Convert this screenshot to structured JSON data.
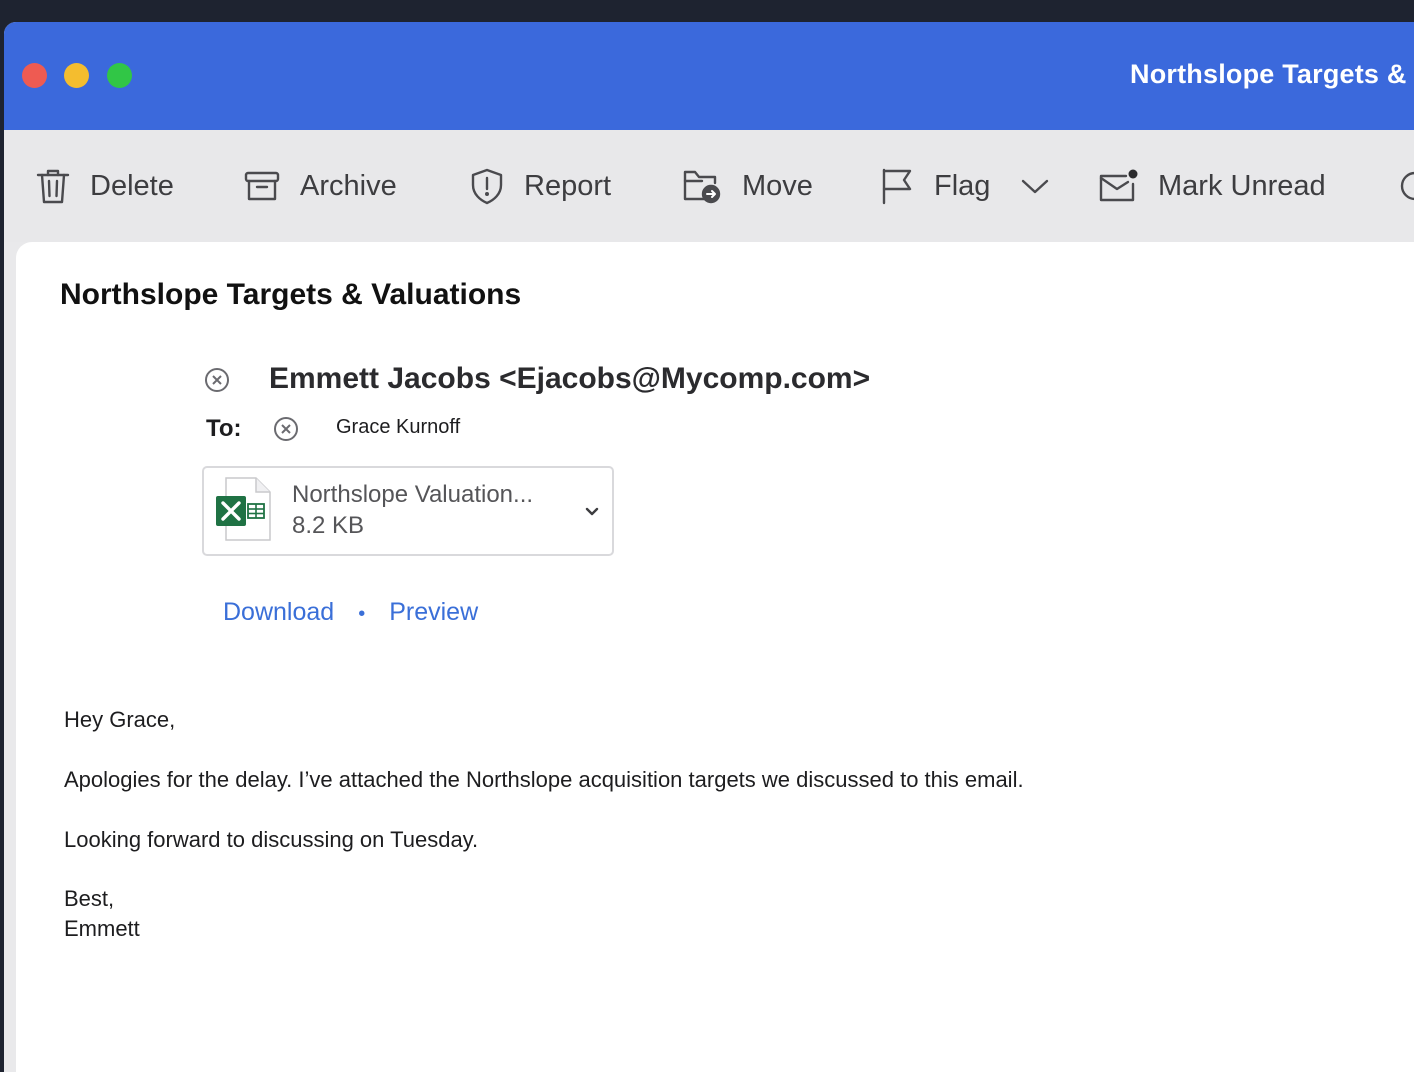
{
  "window": {
    "title": "Northslope Targets &"
  },
  "toolbar": {
    "delete_label": "Delete",
    "archive_label": "Archive",
    "report_label": "Report",
    "move_label": "Move",
    "flag_label": "Flag",
    "mark_unread_label": "Mark Unread"
  },
  "email": {
    "subject": "Northslope Targets & Valuations",
    "sender": "Emmett Jacobs <Ejacobs@Mycomp.com>",
    "to_label": "To:",
    "recipient": "Grace Kurnoff",
    "attachment": {
      "name": "Northslope Valuation...",
      "size": "8.2 KB",
      "download_label": "Download",
      "separator": "•",
      "preview_label": "Preview"
    },
    "body": {
      "greeting": "Hey Grace,",
      "paragraph1": "Apologies for the delay. I’ve attached the Northslope acquisition targets we discussed to this email.",
      "paragraph2": "Looking forward to discussing on Tuesday.",
      "signoff": "Best,",
      "signature": "Emmett"
    }
  },
  "colors": {
    "titlebar": "#3b69dc",
    "link": "#3a6fd8",
    "excel_green": "#1f7244"
  },
  "icons": {
    "delete": "trash-icon",
    "archive": "archive-box-icon",
    "report": "shield-icon",
    "move": "folder-move-icon",
    "flag": "flag-icon",
    "flag_menu": "chevron-down-icon",
    "mark_unread": "envelope-dot-icon",
    "remove": "close-circle-icon",
    "attachment": "excel-file-icon"
  }
}
